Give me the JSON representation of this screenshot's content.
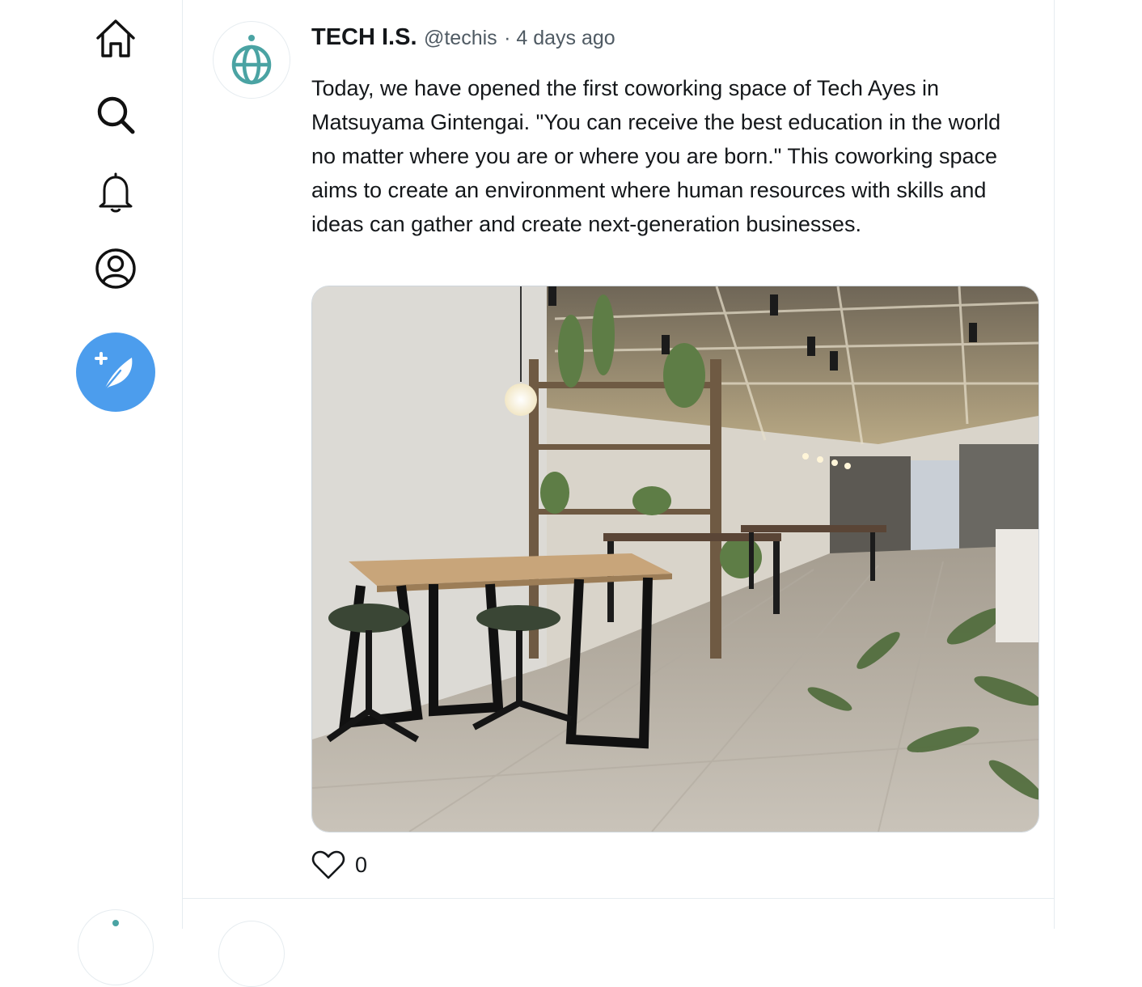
{
  "nav": {
    "items": [
      {
        "name": "home",
        "icon": "home-icon"
      },
      {
        "name": "search",
        "icon": "search-icon"
      },
      {
        "name": "notifications",
        "icon": "bell-icon"
      },
      {
        "name": "profile",
        "icon": "user-icon"
      }
    ],
    "compose_icon": "feather-plus-icon",
    "accent_color": "#4c9ded"
  },
  "post": {
    "author_name": "TECH I.S.",
    "author_handle": "@techis",
    "time_ago": "· 4 days ago",
    "text": "Today, we have opened the first coworking space of Tech Ayes in Matsuyama Gintengai. \"You can receive the best education in the world no matter where you are or where you are born.\" This coworking space aims to create an environment where human resources with skills and ideas can gather and create next-generation businesses.",
    "avatar_icon": "globe-logo-icon",
    "avatar_color": "#4aa3a3",
    "like_count": "0",
    "like_icon": "heart-icon"
  }
}
